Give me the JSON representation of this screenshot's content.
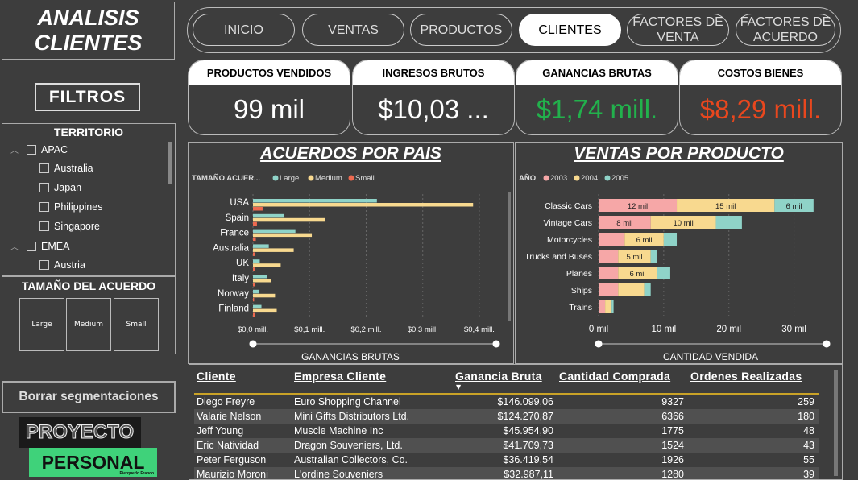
{
  "sidebar": {
    "title_line1": "ANALISIS",
    "title_line2": "CLIENTES",
    "filters_label": "FILTROS",
    "territory": {
      "heading": "TERRITORIO",
      "items": [
        {
          "label": "APAC",
          "level": 0
        },
        {
          "label": "Australia",
          "level": 1
        },
        {
          "label": "Japan",
          "level": 1
        },
        {
          "label": "Philippines",
          "level": 1
        },
        {
          "label": "Singapore",
          "level": 1
        },
        {
          "label": "EMEA",
          "level": 0
        },
        {
          "label": "Austria",
          "level": 1
        }
      ]
    },
    "deal_size": {
      "heading": "TAMAÑO DEL ACUERDO",
      "options": [
        "Large",
        "Medium",
        "Small"
      ]
    },
    "clear_label": "Borrar segmentaciones",
    "logo_line1": "PROYECTO",
    "logo_line2": "PERSONAL",
    "logo_tag": "Pierquedo Franco"
  },
  "nav": {
    "tabs": [
      {
        "label": "INICIO"
      },
      {
        "label": "VENTAS"
      },
      {
        "label": "PRODUCTOS"
      },
      {
        "label": "CLIENTES",
        "active": true
      },
      {
        "label": "FACTORES DE VENTA"
      },
      {
        "label": "FACTORES DE ACUERDO"
      }
    ]
  },
  "kpis": [
    {
      "label": "PRODUCTOS VENDIDOS",
      "value": "99 mil",
      "color": "#ffffff"
    },
    {
      "label": "INGRESOS BRUTOS",
      "value": "$10,03 ...",
      "color": "#ffffff"
    },
    {
      "label": "GANANCIAS BRUTAS",
      "value": "$1,74 mill.",
      "color": "#22b14c"
    },
    {
      "label": "COSTOS BIENES",
      "value": "$8,29 mill.",
      "color": "#e8471e"
    }
  ],
  "colors": {
    "large": "#8fd3c8",
    "medium": "#f8d98f",
    "small": "#ee6a50",
    "y2003": "#f6a7a7",
    "y2004": "#f8d98f",
    "y2005": "#8fd3c8"
  },
  "chart_data": [
    {
      "type": "bar",
      "title": "ACUERDOS POR PAIS",
      "legend_title": "TAMAÑO ACUER...",
      "xlabel": "GANANCIAS BRUTAS",
      "categories": [
        "USA",
        "Spain",
        "France",
        "Australia",
        "UK",
        "Italy",
        "Norway",
        "Finland"
      ],
      "x_ticks": [
        "$0,0 mill.",
        "$0,1 mill.",
        "$0,2 mill.",
        "$0,3 mill.",
        "$0,4 mill."
      ],
      "xlim": [
        0,
        0.42
      ],
      "series": [
        {
          "name": "Large",
          "values": [
            0.219,
            0.055,
            0.075,
            0.028,
            0.012,
            0.025,
            0.01,
            0.015
          ]
        },
        {
          "name": "Medium",
          "values": [
            0.389,
            0.128,
            0.104,
            0.072,
            0.049,
            0.032,
            0.039,
            0.042
          ]
        },
        {
          "name": "Small",
          "values": [
            0.017,
            0.007,
            0.005,
            0.003,
            0.003,
            0.003,
            0.002,
            0.004
          ]
        }
      ]
    },
    {
      "type": "bar",
      "stacked": true,
      "title": "VENTAS POR PRODUCTO",
      "legend_title": "AÑO",
      "xlabel": "CANTIDAD VENDIDA",
      "categories": [
        "Classic Cars",
        "Vintage Cars",
        "Motorcycles",
        "Trucks and Buses",
        "Planes",
        "Ships",
        "Trains"
      ],
      "x_ticks": [
        "0 mil",
        "10 mil",
        "20 mil",
        "30 mil"
      ],
      "xlim": [
        0,
        35
      ],
      "series": [
        {
          "name": "2003",
          "values": [
            12,
            8,
            4,
            3,
            3,
            3,
            1
          ],
          "labels": [
            "12 mil",
            "8 mil",
            "",
            "",
            "",
            "",
            ""
          ]
        },
        {
          "name": "2004",
          "values": [
            15,
            10,
            6,
            5,
            6,
            4,
            1
          ],
          "labels": [
            "15 mil",
            "10 mil",
            "6 mil",
            "5 mil",
            "6 mil",
            "",
            ""
          ]
        },
        {
          "name": "2005",
          "values": [
            6,
            4,
            2,
            1,
            2,
            1,
            0.3
          ],
          "labels": [
            "6 mil",
            "",
            "",
            "",
            "",
            "",
            ""
          ]
        }
      ]
    }
  ],
  "table": {
    "headers": [
      "Cliente",
      "Empresa Cliente",
      "Ganancia Bruta",
      "Cantidad Comprada",
      "Ordenes Realizadas"
    ],
    "rows": [
      [
        "Diego Freyre",
        "Euro Shopping Channel",
        "$146.099,06",
        "9327",
        "259"
      ],
      [
        "Valarie Nelson",
        "Mini Gifts Distributors Ltd.",
        "$124.270,87",
        "6366",
        "180"
      ],
      [
        "Jeff Young",
        "Muscle Machine Inc",
        "$45.954,90",
        "1775",
        "48"
      ],
      [
        "Eric Natividad",
        "Dragon Souveniers, Ltd.",
        "$41.709,73",
        "1524",
        "43"
      ],
      [
        "Peter Ferguson",
        "Australian Collectors, Co.",
        "$36.419,54",
        "1926",
        "55"
      ],
      [
        "Maurizio Moroni",
        "L'ordine Souveniers",
        "$32.987,11",
        "1280",
        "39"
      ]
    ]
  }
}
